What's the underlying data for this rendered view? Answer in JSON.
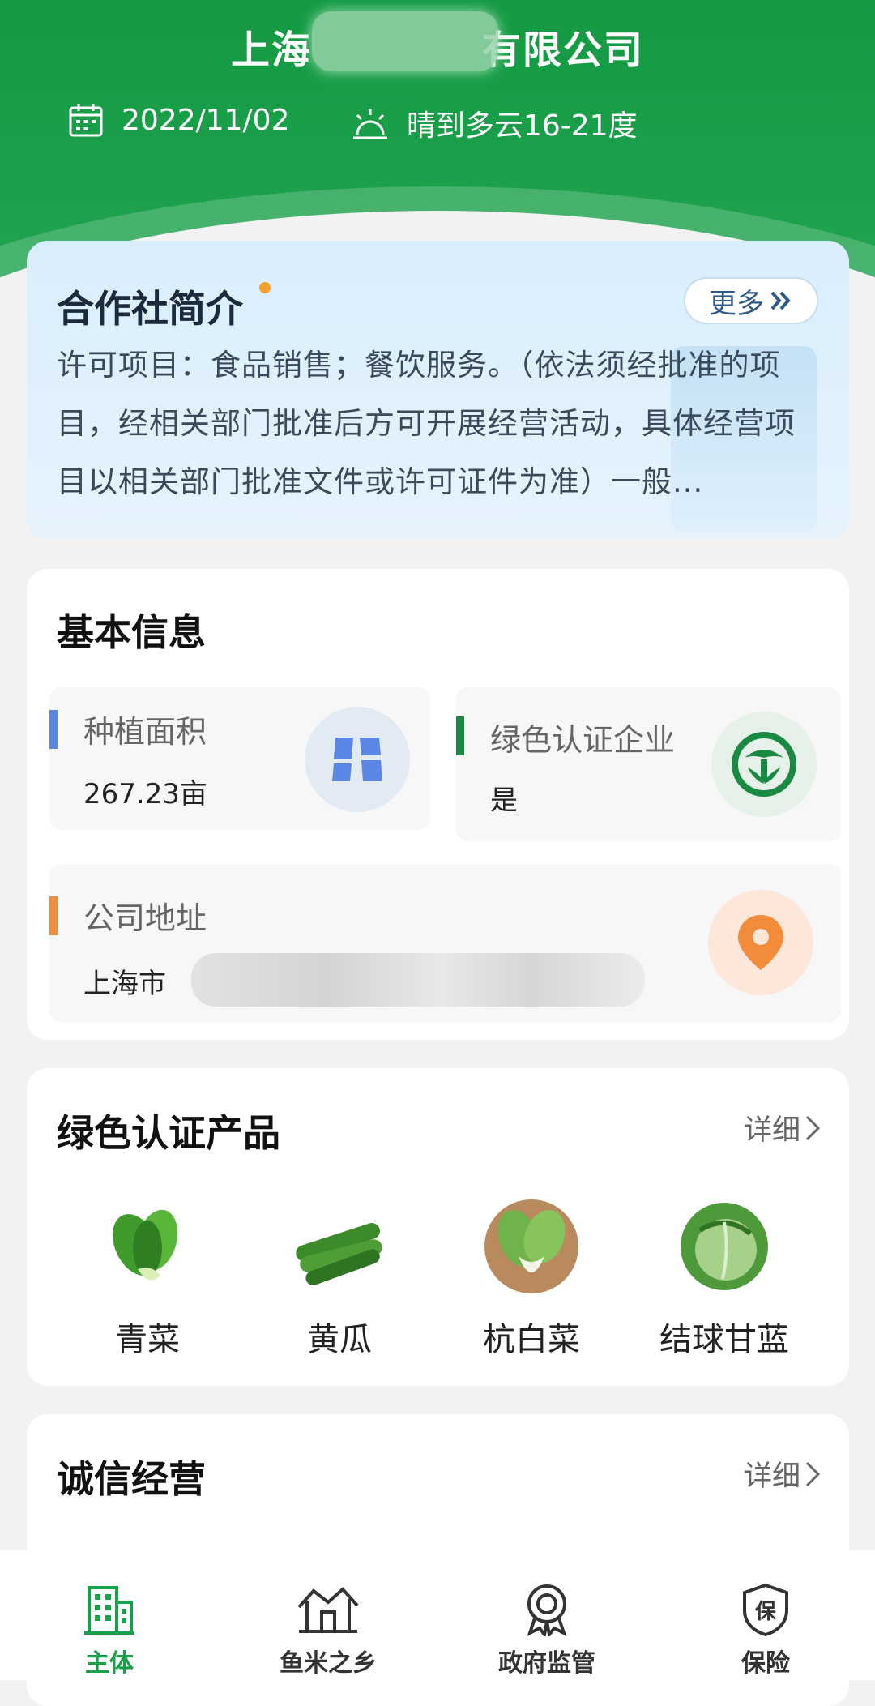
{
  "header": {
    "company_prefix": "上海",
    "company_suffix": "有限公司",
    "date": "2022/11/02",
    "weather": "晴到多云16-21度"
  },
  "intro": {
    "title": "合作社简介",
    "more_label": "更多",
    "text": "许可项目：食品销售；餐饮服务。（依法须经批准的项目，经相关部门批准后方可开展经营活动，具体经营项目以相关部门批准文件或许可证件为准）一般..."
  },
  "basic_info": {
    "title": "基本信息",
    "area_label": "种植面积",
    "area_value": "267.23亩",
    "green_label": "绿色认证企业",
    "green_value": "是",
    "address_label": "公司地址",
    "address_value": "上海市"
  },
  "products": {
    "title": "绿色认证产品",
    "detail_label": "详细",
    "items": [
      {
        "name": "青菜"
      },
      {
        "name": "黄瓜"
      },
      {
        "name": "杭白菜"
      },
      {
        "name": "结球甘蓝"
      }
    ]
  },
  "credit": {
    "title": "诚信经营",
    "detail_label": "详细"
  },
  "tabbar": {
    "items": [
      {
        "label": "主体",
        "icon": "building-icon",
        "active": true
      },
      {
        "label": "鱼米之乡",
        "icon": "village-icon",
        "active": false
      },
      {
        "label": "政府监管",
        "icon": "badge-icon",
        "active": false
      },
      {
        "label": "保险",
        "icon": "shield-icon",
        "active": false
      }
    ]
  },
  "colors": {
    "brand_green": "#1aa048",
    "area_bar": "#5b86e5",
    "green_bar": "#1a8a43",
    "address_bar": "#f28c3a"
  }
}
